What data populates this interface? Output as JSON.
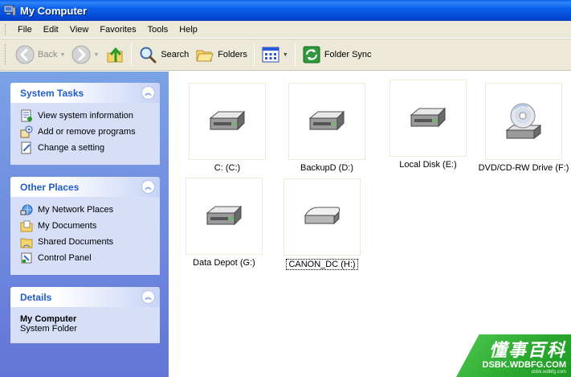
{
  "window": {
    "title": "My Computer"
  },
  "menu": [
    "File",
    "Edit",
    "View",
    "Favorites",
    "Tools",
    "Help"
  ],
  "toolbar": {
    "back": "Back",
    "search": "Search",
    "folders": "Folders",
    "folder_sync": "Folder Sync"
  },
  "sidebar": {
    "system_tasks": {
      "title": "System Tasks",
      "items": [
        "View system information",
        "Add or remove programs",
        "Change a setting"
      ]
    },
    "other_places": {
      "title": "Other Places",
      "items": [
        "My Network Places",
        "My Documents",
        "Shared Documents",
        "Control Panel"
      ]
    },
    "details": {
      "title": "Details",
      "name": "My Computer",
      "type": "System Folder"
    }
  },
  "drives": [
    {
      "label": "C: (C:)",
      "icon": "hard-drive-icon"
    },
    {
      "label": "BackupD (D:)",
      "icon": "hard-drive-icon"
    },
    {
      "label": "Local Disk (E:)",
      "icon": "hard-drive-icon"
    },
    {
      "label": "DVD/CD-RW Drive (F:)",
      "icon": "cd-drive-icon"
    },
    {
      "label": "Data Depot (G:)",
      "icon": "hard-drive-icon"
    },
    {
      "label": "CANON_DC (H:)",
      "icon": "removable-drive-icon"
    }
  ],
  "watermark": {
    "main": "懂事百科",
    "url": "DSBK.WDBFG.COM",
    "small": "dsbk.wdbfg.com"
  },
  "colors": {
    "titlebar": "#0a5fe8",
    "sidebar": "#6f8ee0",
    "panel_title": "#215dc6",
    "watermark": "#2aa82e"
  }
}
